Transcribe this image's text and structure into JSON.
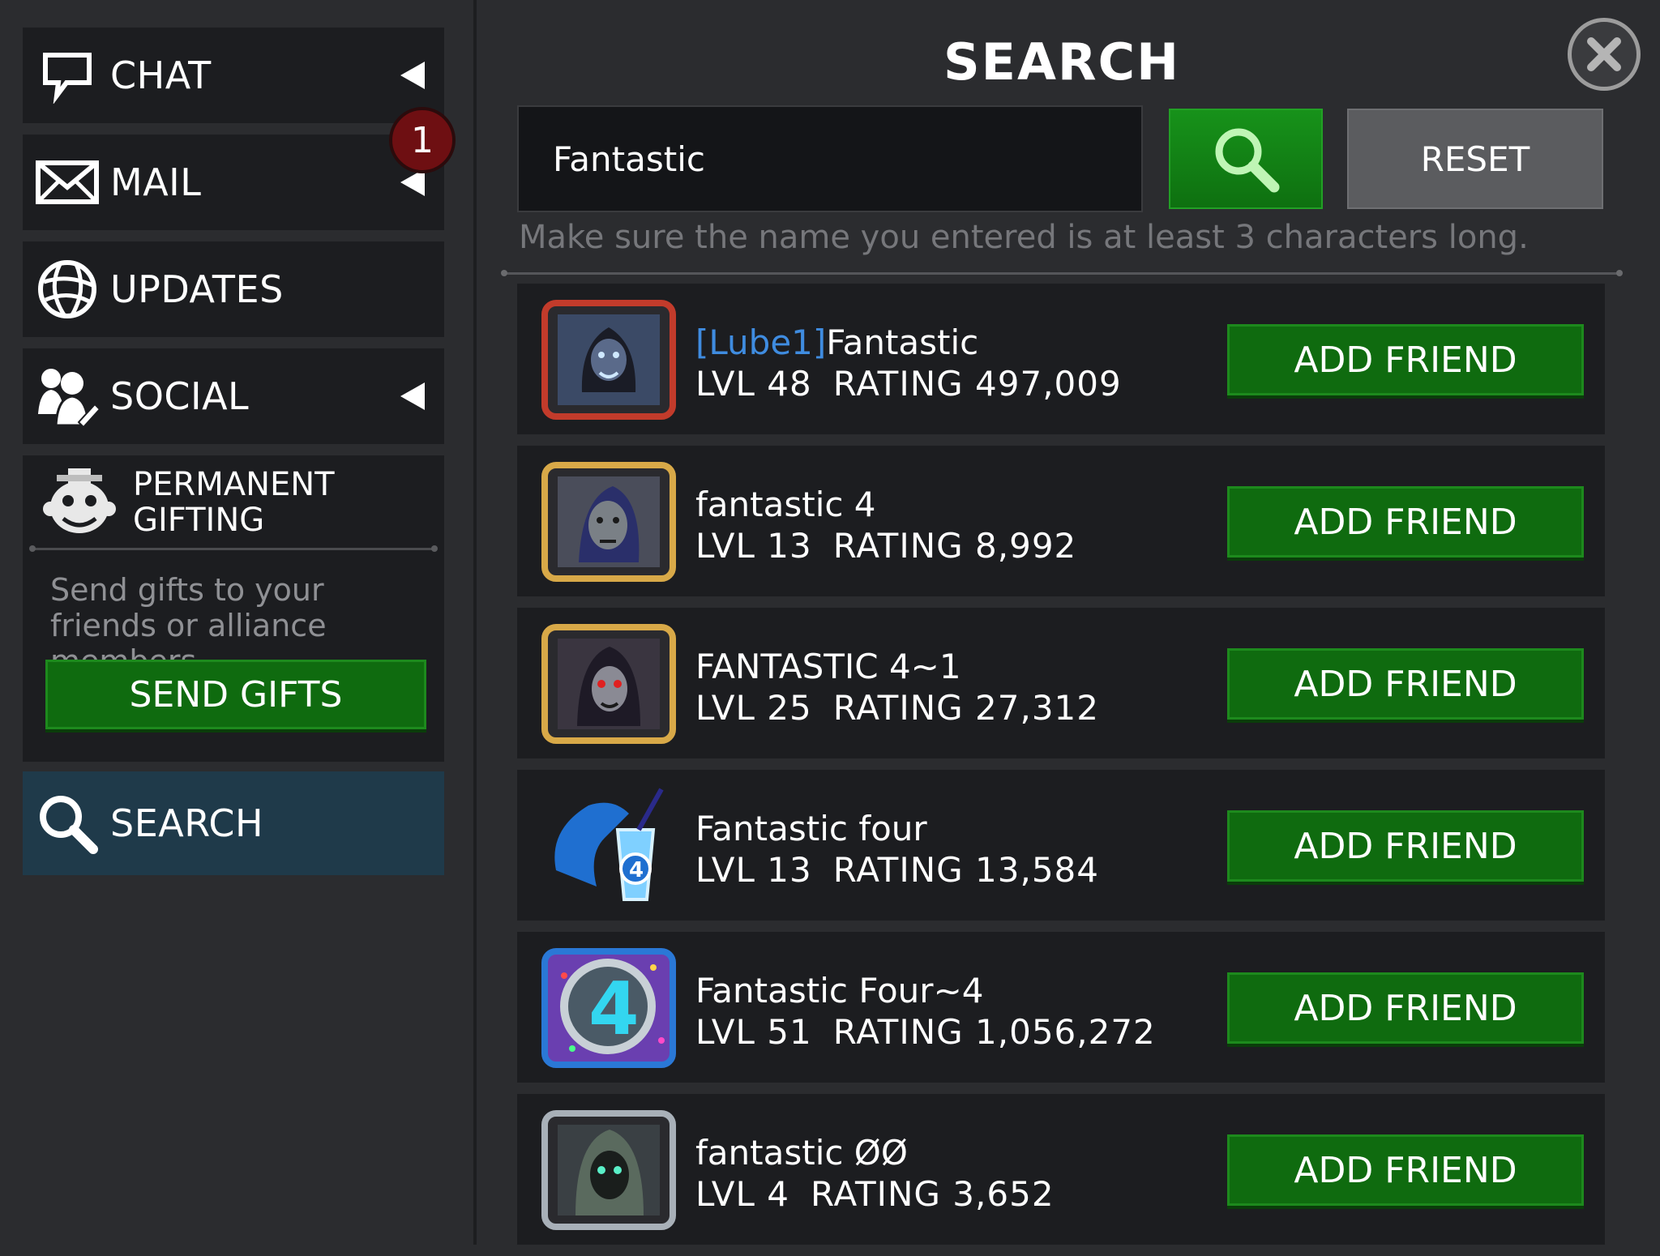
{
  "sidebar": {
    "chat": {
      "label": "CHAT",
      "icon": "chat-bubble-icon"
    },
    "mail": {
      "label": "MAIL",
      "icon": "envelope-icon",
      "badge": "1"
    },
    "updates": {
      "label": "UPDATES",
      "icon": "globe-icon"
    },
    "social": {
      "label": "SOCIAL",
      "icon": "people-icon"
    },
    "gifting": {
      "title_line1": "PERMANENT",
      "title_line2": "GIFTING",
      "icon": "gift-mascot-icon",
      "description": "Send gifts to your friends or alliance members.",
      "button": "SEND GIFTS"
    },
    "search": {
      "label": "SEARCH",
      "icon": "magnifier-icon"
    }
  },
  "main": {
    "title": "SEARCH",
    "search_value": "Fantastic",
    "reset_label": "RESET",
    "hint": "Make sure the name you entered is at least 3 characters long.",
    "add_friend_label": "ADD FRIEND",
    "results": [
      {
        "tag": "[Lube1]",
        "name": "Fantastic",
        "level": "LVL 48",
        "rating": "RATING 497,009"
      },
      {
        "tag": "",
        "name": "fantastic  4",
        "level": "LVL 13",
        "rating": "RATING 8,992"
      },
      {
        "tag": "",
        "name": "FANTASTIC  4~1",
        "level": "LVL 25",
        "rating": "RATING 27,312"
      },
      {
        "tag": "",
        "name": "Fantastic  four",
        "level": "LVL 13",
        "rating": "RATING 13,584"
      },
      {
        "tag": "",
        "name": "Fantastic  Four~4",
        "level": "LVL 51",
        "rating": "RATING 1,056,272"
      },
      {
        "tag": "",
        "name": "fantastic ØØ",
        "level": "LVL 4",
        "rating": "RATING 3,652"
      }
    ]
  },
  "colors": {
    "background": "#2b2c2f",
    "panel": "#1c1d20",
    "accent_green": "#0f6b0f",
    "selected_nav": "#1f3a4a",
    "badge_red": "#6e0f12",
    "alliance_tag_blue": "#3f8ce0"
  }
}
